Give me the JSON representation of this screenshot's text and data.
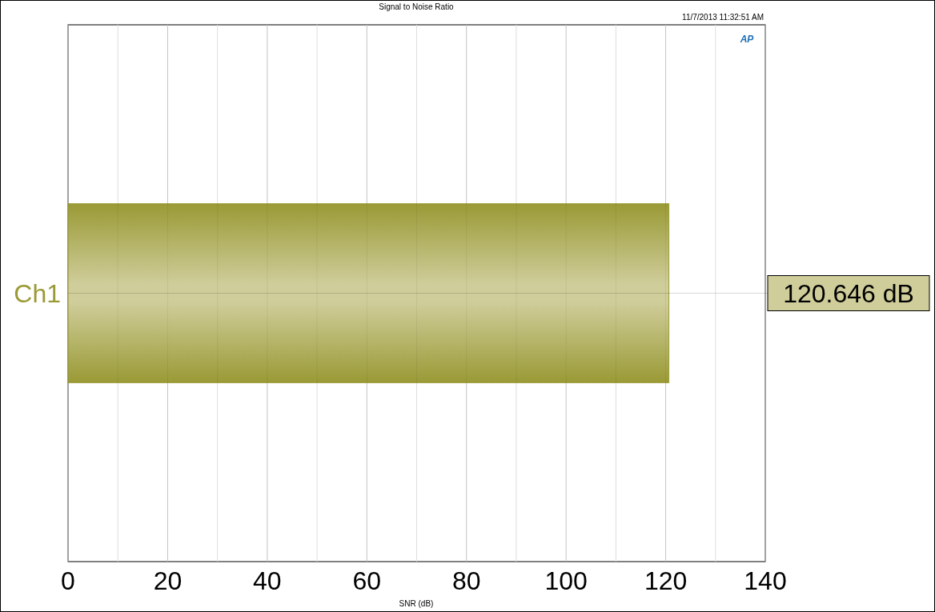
{
  "timestamp": "11/7/2013 11:32:51 AM",
  "logo": "AP",
  "chart_data": {
    "type": "bar",
    "orientation": "horizontal",
    "title": "Signal to Noise Ratio",
    "xlabel": "SNR (dB)",
    "categories": [
      "Ch1"
    ],
    "series": [
      {
        "color": "#9a9a36",
        "values": [
          120.646
        ]
      }
    ],
    "grid": true,
    "xlim": [
      0,
      140
    ],
    "xticks": [
      0,
      20,
      40,
      60,
      80,
      100,
      120,
      140
    ],
    "value_labels": [
      "120.646 dB"
    ]
  }
}
